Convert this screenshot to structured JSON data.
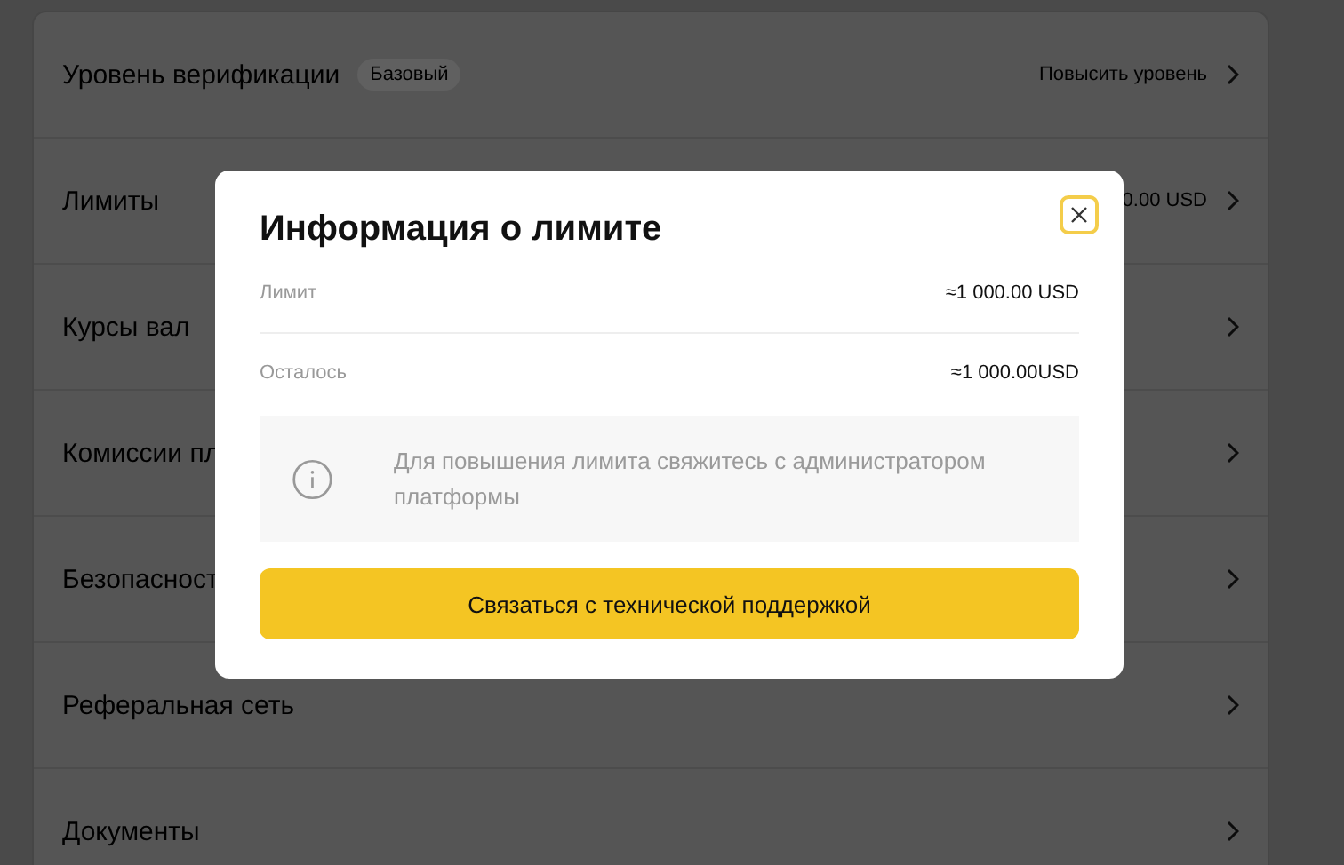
{
  "settings": [
    {
      "label": "Уровень верификации",
      "badge": "Базовый",
      "value": "Повысить уровень"
    },
    {
      "label": "Лимиты",
      "value": "0.00 USD"
    },
    {
      "label": "Курсы вал"
    },
    {
      "label": "Комиссии пл"
    },
    {
      "label": "Безопасност"
    },
    {
      "label": "Реферальная сеть"
    },
    {
      "label": "Документы"
    }
  ],
  "modal": {
    "title": "Информация о лимите",
    "rows": [
      {
        "label": "Лимит",
        "value": "≈1 000.00 USD"
      },
      {
        "label": "Осталось",
        "value": "≈1 000.00USD"
      }
    ],
    "info": "Для повышения лимита свяжитесь с администратором платформы",
    "button": "Связаться с технической поддержкой"
  }
}
